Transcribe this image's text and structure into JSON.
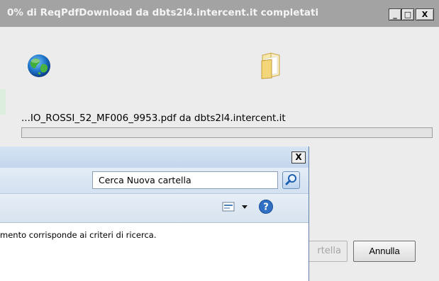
{
  "download_dialog": {
    "title": "0% di ReqPdfDownload da dbts2l4.intercent.it completati",
    "window_buttons": {
      "minimize": "_",
      "maximize": "□",
      "close": "X"
    },
    "filename_text": "...IO_ROSSI_52_MF006_9953.pdf da dbts2l4.intercent.it",
    "progress": 0,
    "open_folder_label": "rtella",
    "cancel_label": "Annulla",
    "icons": [
      "globe-icon",
      "folder-icon"
    ]
  },
  "explorer_window": {
    "close_label": "X",
    "search": {
      "value": "Cerca Nuova cartella"
    },
    "empty_message": "mento corrisponde ai criteri di ricerca.",
    "icons": [
      "refresh-icon",
      "search-icon",
      "view-icon",
      "help-icon",
      "chevron-down-icon"
    ],
    "colors": {
      "titlebar": "#c3d6ec",
      "accent": "#5f7fa8"
    }
  }
}
